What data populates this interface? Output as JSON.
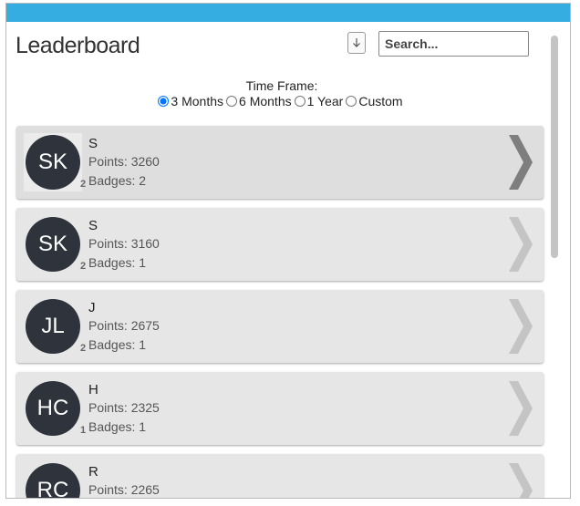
{
  "header": {
    "title": "Leaderboard",
    "sort_icon": "down-arrow-icon",
    "search_placeholder": "Search..."
  },
  "time_frame": {
    "label": "Time Frame:",
    "options": [
      "3 Months",
      "6 Months",
      "1 Year",
      "Custom"
    ],
    "selected": "3 Months"
  },
  "colors": {
    "topbar": "#35ade0",
    "avatar": "#2e333c",
    "chevron_active": "#7e7e7e",
    "chevron_inactive": "#c4c4c4"
  },
  "leaders": [
    {
      "initials": "SK",
      "rank": "2",
      "name": "S",
      "points": "Points: 3260",
      "badges": "Badges: 2"
    },
    {
      "initials": "SK",
      "rank": "2",
      "name": "S",
      "points": "Points: 3160",
      "badges": "Badges: 1"
    },
    {
      "initials": "JL",
      "rank": "2",
      "name": "J",
      "points": "Points: 2675",
      "badges": "Badges: 1"
    },
    {
      "initials": "HC",
      "rank": "1",
      "name": "H",
      "points": "Points: 2325",
      "badges": "Badges: 1"
    },
    {
      "initials": "RC",
      "rank": "",
      "name": "R",
      "points": "Points: 2265",
      "badges": ""
    }
  ]
}
